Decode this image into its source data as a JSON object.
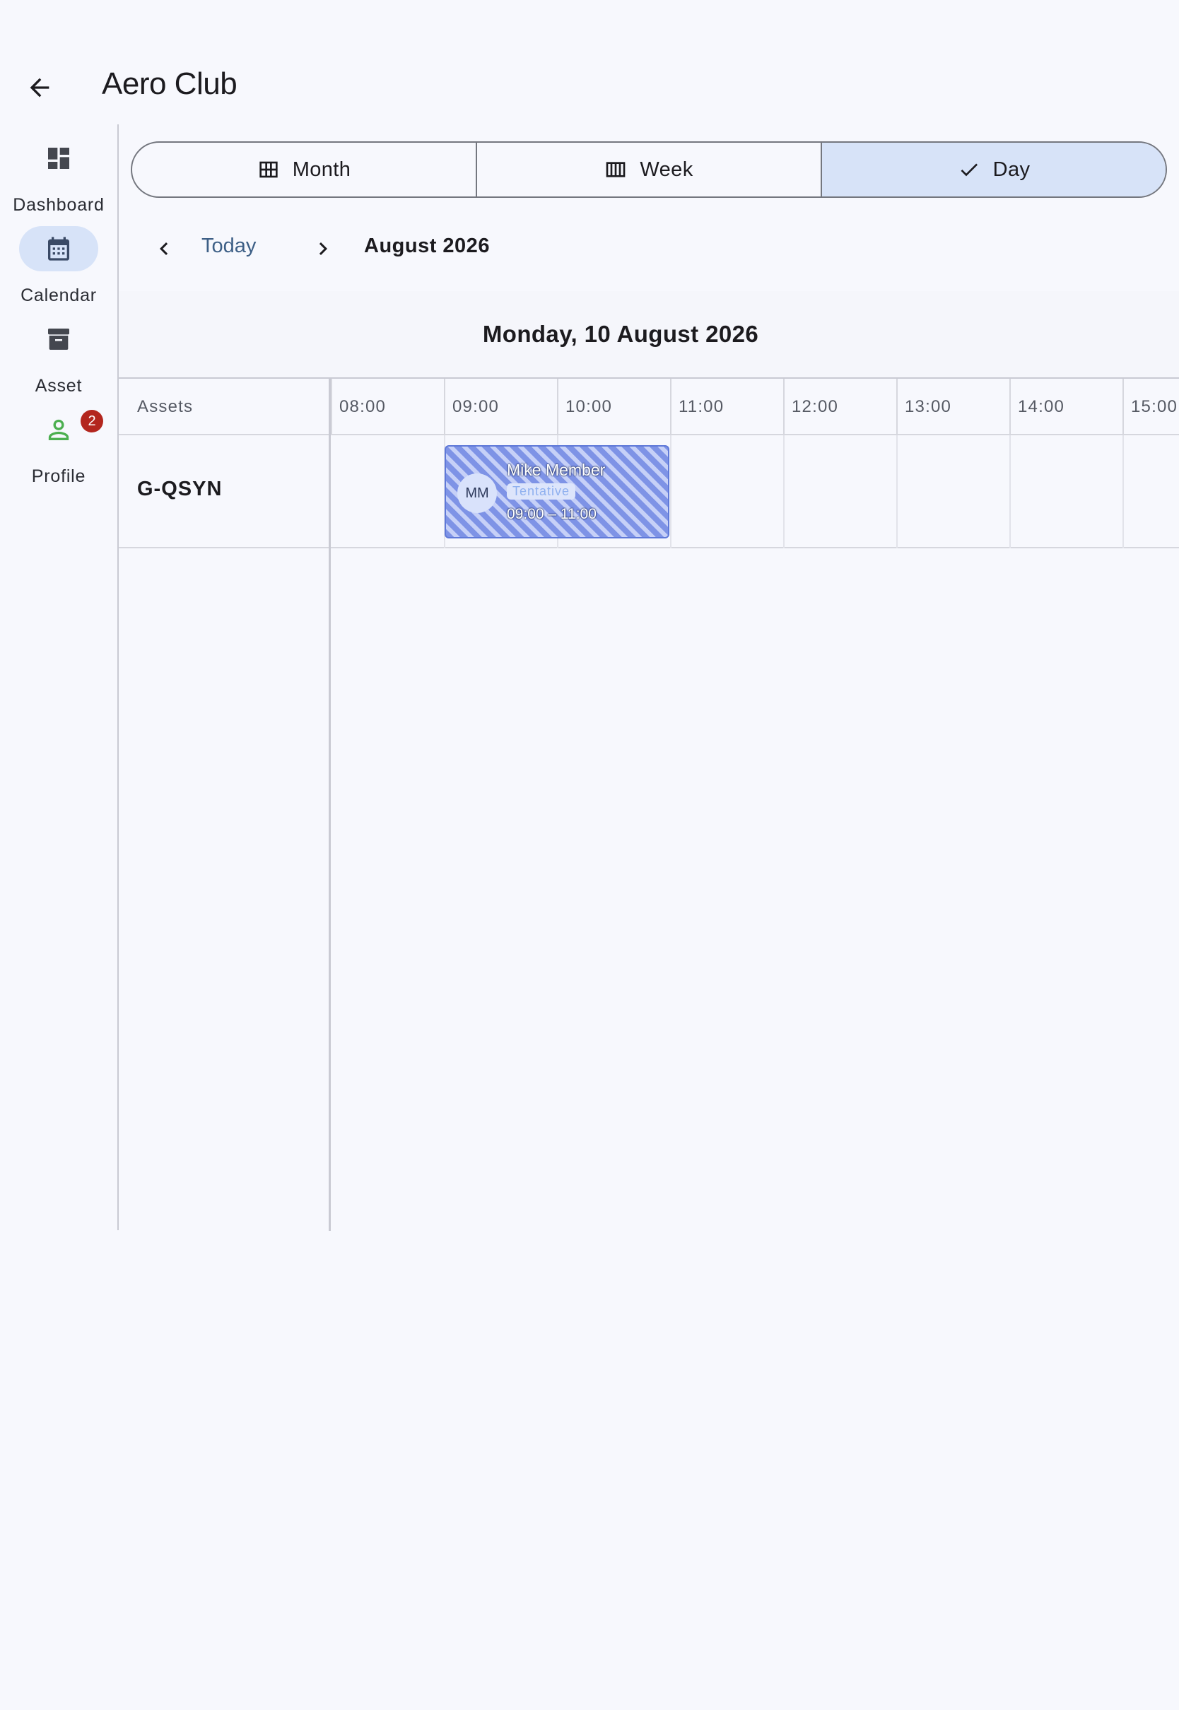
{
  "app": {
    "title": "Aero Club"
  },
  "rail": {
    "items": [
      {
        "label": "Dashboard",
        "icon": "dashboard-icon",
        "active": false
      },
      {
        "label": "Calendar",
        "icon": "calendar-icon",
        "active": true
      },
      {
        "label": "Asset",
        "icon": "archive-icon",
        "active": false
      },
      {
        "label": "Profile",
        "icon": "person-icon",
        "active": false,
        "badge": "2"
      }
    ]
  },
  "view_toggle": {
    "month": "Month",
    "week": "Week",
    "day": "Day",
    "selected": "Day"
  },
  "date_nav": {
    "today": "Today",
    "month": "August 2026"
  },
  "calendar": {
    "day_title": "Monday, 10 August 2026",
    "assets_header": "Assets",
    "hours": [
      "08:00",
      "09:00",
      "10:00",
      "11:00",
      "12:00",
      "13:00",
      "14:00",
      "15:00"
    ],
    "assets": [
      {
        "name": "G-QSYN",
        "bookings": [
          {
            "initials": "MM",
            "member": "Mike Member",
            "status": "Tentative",
            "time": "09:00 – 11:00"
          }
        ]
      }
    ]
  },
  "colors": {
    "accent": "#d7e3f8",
    "link": "#3d5f86",
    "booking_stripe": "#7e93e6",
    "badge": "#b3261e",
    "profile_icon": "#4caf50"
  }
}
